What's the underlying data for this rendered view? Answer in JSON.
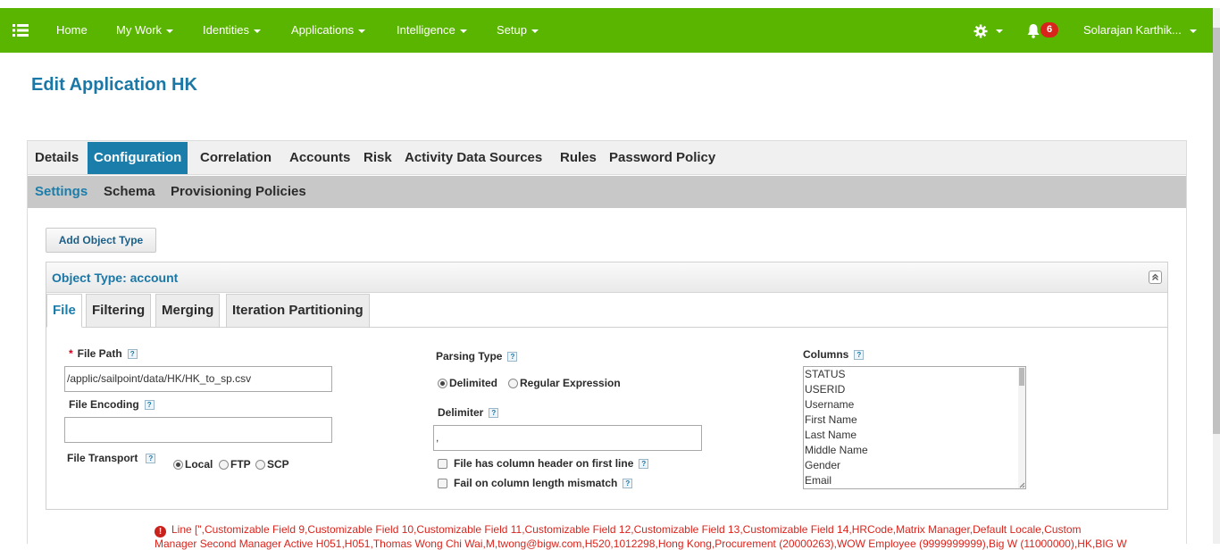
{
  "navbar": {
    "menu_icon": "hamburger-icon",
    "items": [
      {
        "label": "Home"
      },
      {
        "label": "My Work"
      },
      {
        "label": "Identities"
      },
      {
        "label": "Applications"
      },
      {
        "label": "Intelligence"
      },
      {
        "label": "Setup"
      }
    ],
    "settings_icon": "gear-icon",
    "notifications_icon": "bell-icon",
    "notification_count": "6",
    "user_name": "Solarajan Karthik...",
    "brand_color": "#5ab500",
    "badge_color": "#d9241c"
  },
  "page": {
    "title": "Edit Application HK",
    "title_color": "#1b77a6"
  },
  "tabs_main": [
    {
      "label": "Details",
      "active": false
    },
    {
      "label": "Configuration",
      "active": true
    },
    {
      "label": "Correlation",
      "active": false
    },
    {
      "label": "Accounts",
      "active": false
    },
    {
      "label": "Risk",
      "active": false
    },
    {
      "label": "Activity Data Sources",
      "active": false
    },
    {
      "label": "Rules",
      "active": false
    },
    {
      "label": "Password Policy",
      "active": false
    }
  ],
  "tabs_sub": [
    {
      "label": "Settings",
      "active": true
    },
    {
      "label": "Schema",
      "active": false
    },
    {
      "label": "Provisioning Policies",
      "active": false
    }
  ],
  "add_object_type_label": "Add Object Type",
  "object_type": {
    "title": "Object Type: account",
    "collapse_icon": "double-chevron-up-icon",
    "tabs": [
      {
        "label": "File",
        "active": true
      },
      {
        "label": "Filtering",
        "active": false
      },
      {
        "label": "Merging",
        "active": false
      },
      {
        "label": "Iteration Partitioning",
        "active": false
      }
    ]
  },
  "form": {
    "file_path_label": "File Path",
    "file_path_required": "*",
    "file_path_value": "/applic/sailpoint/data/HK/HK_to_sp.csv",
    "file_encoding_label": "File Encoding",
    "file_encoding_value": "",
    "file_transport_label": "File Transport",
    "file_transport_options": [
      "Local",
      "FTP",
      "SCP"
    ],
    "file_transport_selected": "Local",
    "parsing_type_label": "Parsing Type",
    "parsing_type_options": [
      "Delimited",
      "Regular Expression"
    ],
    "parsing_type_selected": "Delimited",
    "delimiter_label": "Delimiter",
    "delimiter_value": ",",
    "header_checkbox_label": "File has column header on first line",
    "header_checkbox_checked": false,
    "mismatch_checkbox_label": "Fail on column length mismatch",
    "mismatch_checkbox_checked": false,
    "columns_label": "Columns",
    "columns": [
      "STATUS",
      "USERID",
      "Username",
      "First Name",
      "Last Name",
      "Middle Name",
      "Gender",
      "Email"
    ],
    "help_icon": "help-icon",
    "help_glyph": "?"
  },
  "error": {
    "icon": "error-icon",
    "glyph": "!",
    "line1": "Line [\",Customizable Field 9,Customizable Field 10,Customizable Field 11,Customizable Field 12,Customizable Field 13,Customizable Field 14,HRCode,Matrix Manager,Default Locale,Custom",
    "line2": "Manager Second Manager Active H051,H051,Thomas Wong Chi Wai,M,twong@bigw.com,H520,1012298,Hong Kong,Procurement (20000263),WOW Employee (9999999999),Big W (11000000),HK,BIG W"
  }
}
